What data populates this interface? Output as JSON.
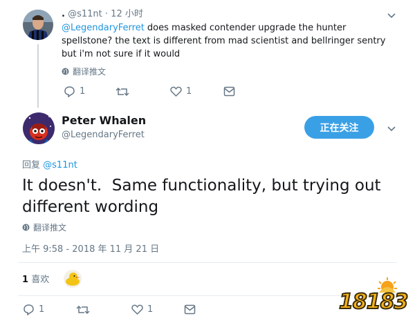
{
  "reply_tweet": {
    "dot": ".",
    "handle": "@s11nt",
    "sep": "·",
    "time": "12 小时",
    "mention": "@LegendaryFerret",
    "text": " does masked contender upgrade the hunter spellstone? the text is different from mad scientist and bellringer sentry but i'm not sure if it would",
    "translate_label": "翻译推文",
    "reply_count": "1",
    "like_count": "1"
  },
  "main_tweet": {
    "display_name": "Peter Whalen",
    "handle": "@LegendaryFerret",
    "follow_label": "正在关注",
    "replying_label": "回复",
    "replying_handle": "@s11nt",
    "text": "It doesn't.  Same functionality, but trying out different wording",
    "translate_label": "翻译推文",
    "timestamp": "上午 9:58 - 2018 年 11 月 21 日",
    "like_count": "1",
    "like_label": "喜欢",
    "reply_count": "1",
    "fav_count": "1"
  },
  "watermark": "18183",
  "colors": {
    "accent": "#1b95e0",
    "follow_bg": "#3aa0e6",
    "muted": "#657786"
  }
}
